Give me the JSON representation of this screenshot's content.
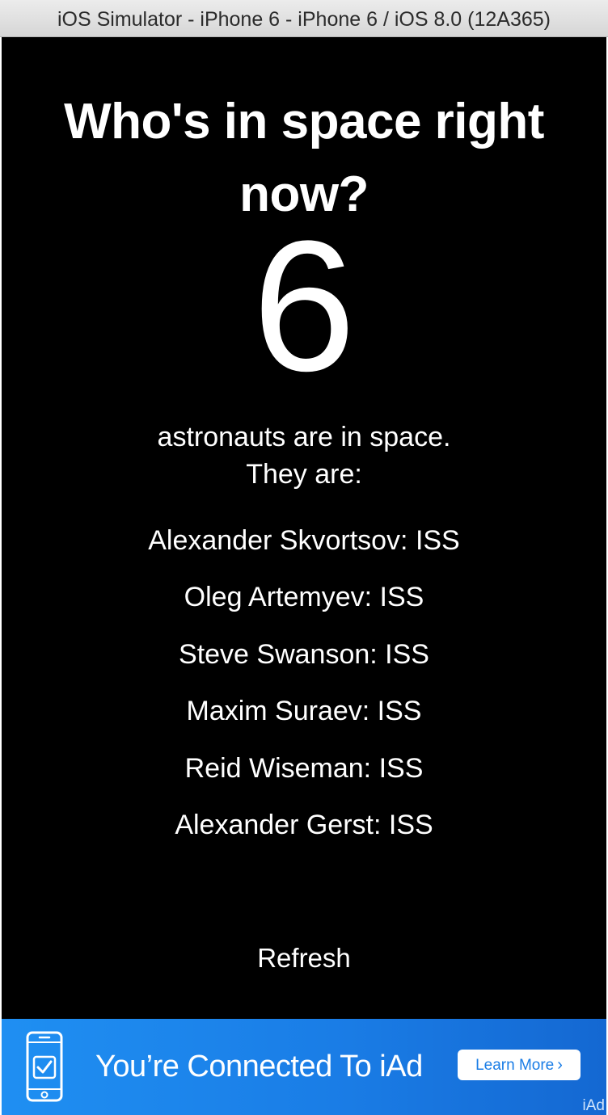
{
  "window": {
    "title": "iOS Simulator - iPhone 6 - iPhone 6 / iOS 8.0 (12A365)"
  },
  "app": {
    "headline_line1": "Who's in space right",
    "headline_line2": "now?",
    "count": "6",
    "subtitle_line1": "astronauts are in space.",
    "subtitle_line2": "They are:",
    "crew": [
      "Alexander Skvortsov: ISS",
      "Oleg Artemyev: ISS",
      "Steve Swanson: ISS",
      "Maxim Suraev: ISS",
      "Reid Wiseman: ISS",
      "Alexander Gerst: ISS"
    ],
    "refresh_label": "Refresh"
  },
  "ad": {
    "text": "You’re Connected To iAd",
    "button_label": "Learn More",
    "button_chevron": "›",
    "mark": "iAd",
    "phone_icon": "phone-check-icon",
    "colors": {
      "banner_start": "#1f8ff2",
      "banner_end": "#1468d2"
    }
  },
  "colors": {
    "background": "#000000",
    "text": "#ffffff",
    "titlebar": "#e2e2e2"
  }
}
